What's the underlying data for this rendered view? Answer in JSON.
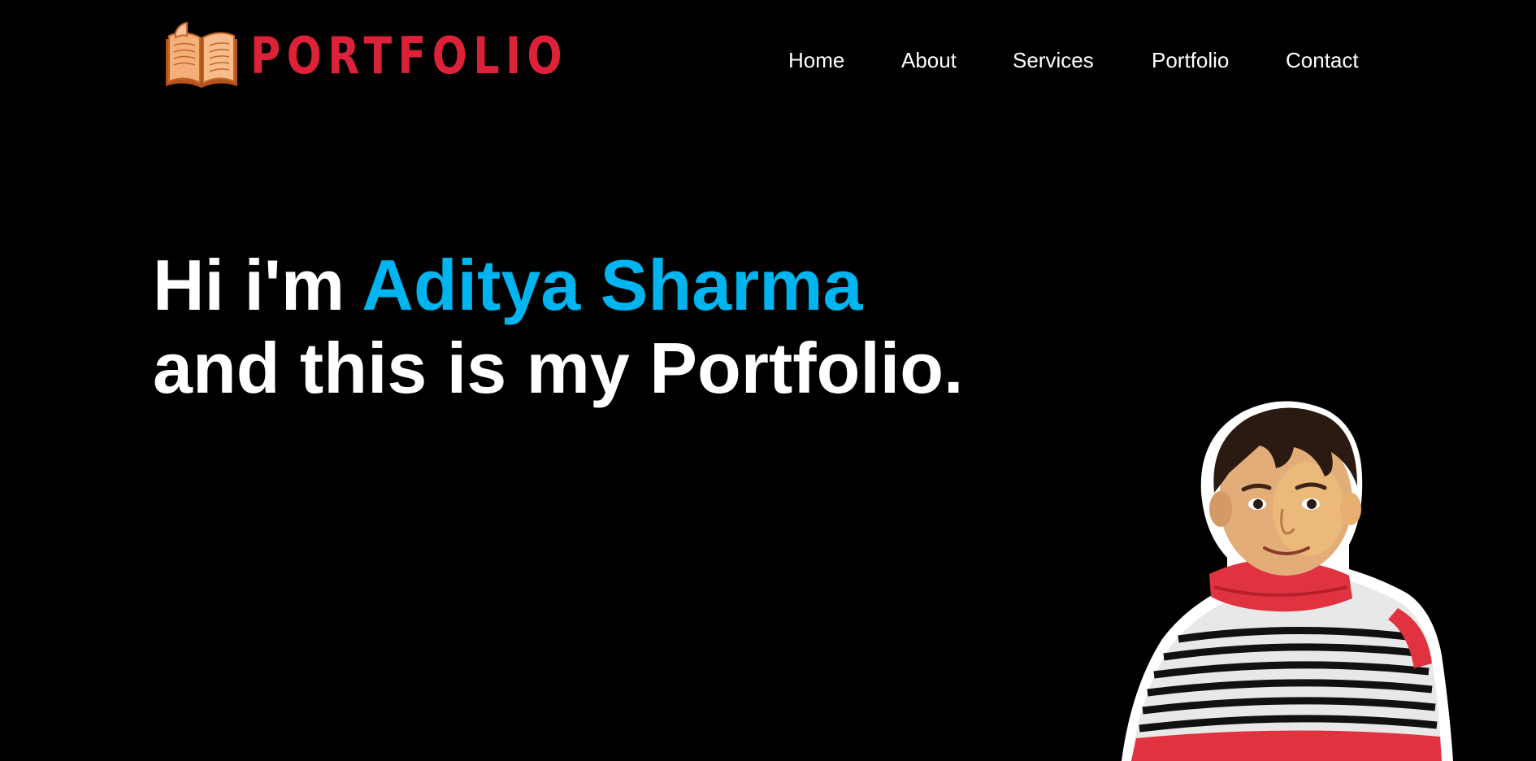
{
  "header": {
    "logo_text": "PORTFOLIO",
    "logo_icon": "open-book-icon"
  },
  "nav": {
    "items": [
      {
        "label": "Home"
      },
      {
        "label": "About"
      },
      {
        "label": "Services"
      },
      {
        "label": "Portfolio"
      },
      {
        "label": "Contact"
      }
    ]
  },
  "hero": {
    "greeting": "Hi i'm ",
    "name": "Aditya Sharma",
    "tagline": "and this is my Portfolio."
  },
  "colors": {
    "background": "#000000",
    "logo_red": "#dc2239",
    "accent_blue": "#00b4f0",
    "text": "#ffffff"
  }
}
